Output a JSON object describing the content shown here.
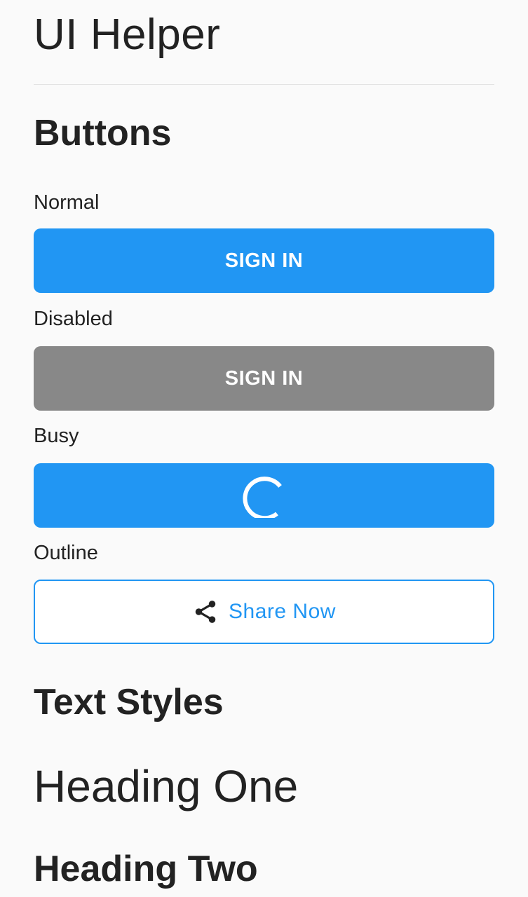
{
  "app": {
    "title": "UI Helper"
  },
  "buttons_section": {
    "heading": "Buttons",
    "normal": {
      "label": "Normal",
      "button_label": "SIGN IN"
    },
    "disabled": {
      "label": "Disabled",
      "button_label": "SIGN IN"
    },
    "busy": {
      "label": "Busy",
      "indicator_icon": "spinner-icon"
    },
    "outline": {
      "label": "Outline",
      "button_label": "Share Now",
      "icon": "share-icon"
    }
  },
  "text_styles_section": {
    "heading": "Text Styles",
    "heading_one": "Heading One",
    "heading_two": "Heading Two"
  },
  "colors": {
    "primary": "#2196f3",
    "disabled": "#888888",
    "background": "#fafafa",
    "text": "#222222"
  }
}
